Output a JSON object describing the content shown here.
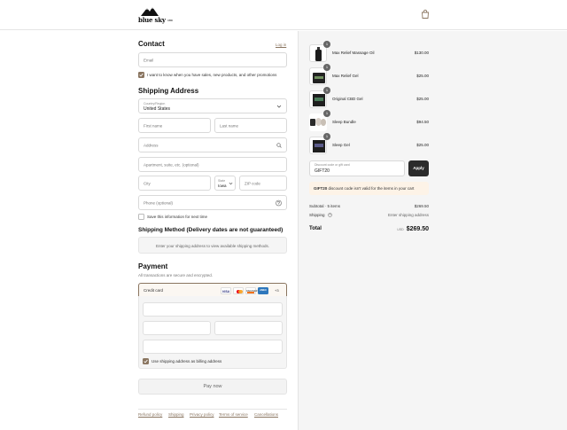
{
  "brand": {
    "logo_text": "blue sky",
    "logo_sub": "CBD"
  },
  "contact": {
    "heading": "Contact",
    "login_link": "Log in",
    "email_placeholder": "Email",
    "marketing_optin": "I want to know when you have sales, new products, and other promotions",
    "marketing_checked": true
  },
  "shipping_address": {
    "heading": "Shipping Address",
    "country_label": "Country/Region",
    "country_value": "United States",
    "first_name_placeholder": "First name",
    "last_name_placeholder": "Last name",
    "address_placeholder": "Address",
    "apartment_placeholder": "Apartment, suite, etc. (optional)",
    "city_placeholder": "City",
    "state_label": "State",
    "state_value": "Iowa",
    "zip_placeholder": "ZIP code",
    "phone_placeholder": "Phone (optional)",
    "save_info": "Save this information for next time",
    "save_checked": false
  },
  "shipping_method": {
    "heading": "Shipping Method (Delivery dates are not guaranteed)",
    "message": "Enter your shipping address to view available shipping methods."
  },
  "payment": {
    "heading": "Payment",
    "subtitle": "All transactions are secure and encrypted.",
    "method_label": "Credit card",
    "card_brands": [
      "VISA",
      "mastercard",
      "DISCOVER",
      "AMEX"
    ],
    "more_cards": "+3",
    "billing_same": "Use shipping address as billing address",
    "billing_checked": true,
    "pay_button": "Pay now"
  },
  "footer_links": [
    "Refund policy",
    "Shipping",
    "Privacy policy",
    "Terms of service",
    "Cancellations"
  ],
  "order": {
    "items": [
      {
        "name": "Max Relief Massage Oil",
        "price": "$130.00",
        "qty": "1",
        "thumb": "bottle"
      },
      {
        "name": "Max Relief Gel",
        "price": "$25.00",
        "qty": "1",
        "thumb": "jar"
      },
      {
        "name": "Original CBD Gel",
        "price": "$25.00",
        "qty": "1",
        "thumb": "box"
      },
      {
        "name": "Sleep Bundle",
        "price": "$94.50",
        "qty": "1",
        "thumb": "bundle"
      },
      {
        "name": "Sleep Gel",
        "price": "$25.00",
        "qty": "1",
        "thumb": "box"
      }
    ],
    "discount_label": "Discount code or gift card",
    "discount_value": "GIFT20",
    "apply_button": "Apply",
    "discount_warning_code": "GIFT20",
    "discount_warning": " discount code isn't valid for the items in your cart",
    "subtotal_label": "Subtotal · 5 items",
    "subtotal_value": "$269.50",
    "shipping_label": "Shipping",
    "shipping_value": "Enter shipping address",
    "total_label": "Total",
    "currency": "USD",
    "total_value": "$269.50"
  },
  "colors": {
    "accent": "#8a7560",
    "warning_bg": "#fdf3e7",
    "apply_bg": "#2b2b2b"
  }
}
